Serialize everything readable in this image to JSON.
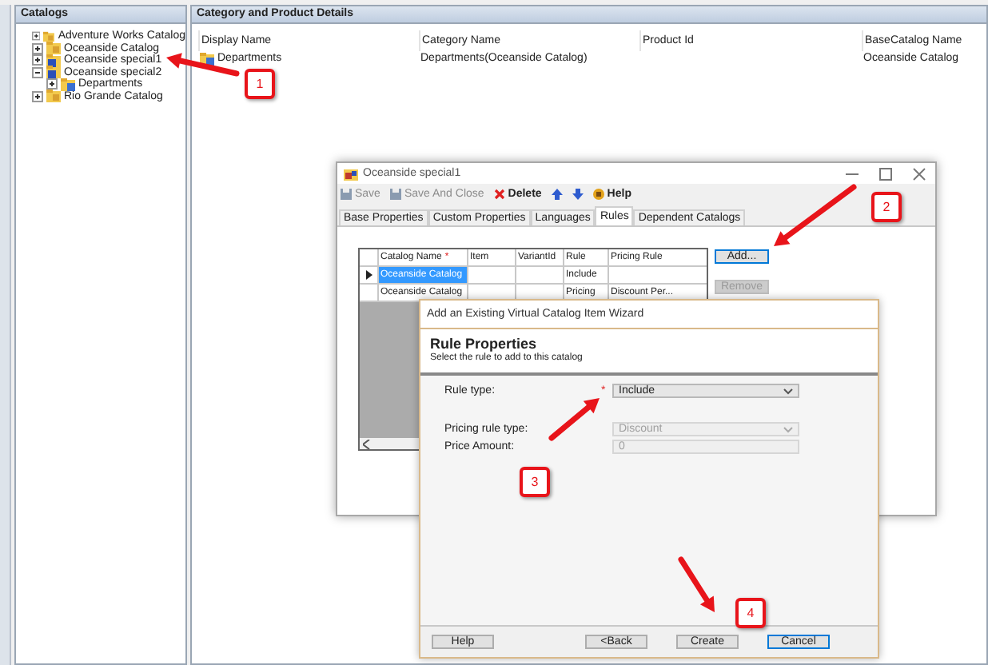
{
  "catalogs": {
    "title": "Catalogs",
    "items": [
      {
        "label": "Adventure Works Catalog",
        "kind": "catalog",
        "expanded": false
      },
      {
        "label": "Oceanside Catalog",
        "kind": "catalog",
        "expanded": false
      },
      {
        "label": "Oceanside special1",
        "kind": "virtual",
        "expanded": false
      },
      {
        "label": "Oceanside special2",
        "kind": "virtual",
        "expanded": true,
        "children": [
          {
            "label": "Departments",
            "kind": "category",
            "expanded": false
          }
        ]
      },
      {
        "label": "Rio Grande Catalog",
        "kind": "catalog",
        "expanded": false
      }
    ]
  },
  "details": {
    "title": "Category and Product Details",
    "columns": [
      "Display Name",
      "Category Name",
      "Product Id",
      "BaseCatalog Name"
    ],
    "rows": [
      {
        "cells": [
          "Departments",
          "Departments(Oceanside Catalog)",
          "",
          "Oceanside Catalog"
        ]
      }
    ]
  },
  "dialog": {
    "title": "Oceanside special1",
    "toolbar": [
      {
        "label": "Save",
        "kind": "save",
        "disabled": true
      },
      {
        "label": "Save And Close",
        "kind": "save",
        "disabled": true
      },
      {
        "label": "Delete",
        "kind": "delete",
        "disabled": false
      },
      {
        "kind": "up",
        "disabled": false
      },
      {
        "kind": "down",
        "disabled": false
      },
      {
        "label": "Help",
        "kind": "help",
        "disabled": false
      }
    ],
    "tabs": [
      {
        "label": "Base Properties",
        "selected": false
      },
      {
        "label": "Custom Properties",
        "selected": false
      },
      {
        "label": "Languages",
        "selected": false
      },
      {
        "label": "Rules",
        "selected": true
      },
      {
        "label": "Dependent Catalogs",
        "selected": false
      }
    ],
    "grid": {
      "columns": [
        {
          "label": "Catalog Name",
          "marker": "*"
        },
        {
          "label": "Item"
        },
        {
          "label": "VariantId"
        },
        {
          "label": "Rule"
        },
        {
          "label": "Pricing Rule"
        }
      ],
      "rows": [
        {
          "current": true,
          "selected": true,
          "cells": [
            "Oceanside Catalog",
            "",
            "",
            "Include",
            ""
          ]
        },
        {
          "current": false,
          "selected": false,
          "cells": [
            "Oceanside Catalog",
            "",
            "",
            "Pricing",
            "Discount Per..."
          ]
        }
      ]
    },
    "buttons": [
      {
        "label": "Add...",
        "focused": true,
        "disabled": false
      },
      {
        "label": "Remove",
        "focused": false,
        "disabled": true
      }
    ]
  },
  "wizard": {
    "title": "Add an Existing Virtual Catalog Item Wizard",
    "heading": "Rule Properties",
    "subtitle": "Select the rule to add to this catalog",
    "fields": [
      {
        "label": "Rule type:",
        "kind": "select",
        "marker": "*",
        "value": "Include",
        "disabled": false
      },
      {
        "label": "Pricing rule type:",
        "kind": "select",
        "value": "Discount",
        "disabled": true
      },
      {
        "label": "Price Amount:",
        "kind": "text",
        "value": "0",
        "disabled": true
      }
    ],
    "buttons": [
      {
        "label": "Help",
        "default": false
      },
      {
        "label": "<Back",
        "default": false
      },
      {
        "label": "Create",
        "default": false
      },
      {
        "label": "Cancel",
        "default": true
      }
    ]
  },
  "annotations": [
    {
      "number": "1"
    },
    {
      "number": "2"
    },
    {
      "number": "3"
    },
    {
      "number": "4"
    }
  ]
}
